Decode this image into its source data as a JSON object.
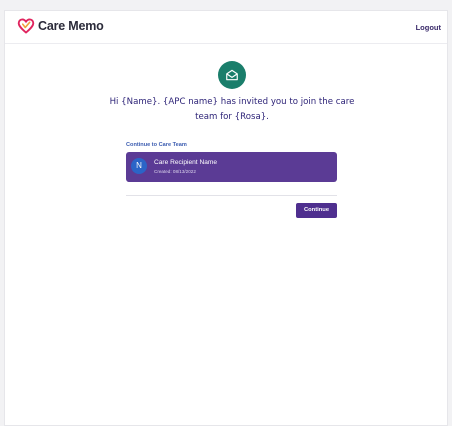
{
  "header": {
    "logo_text": "Care Memo",
    "logout_label": "Logout"
  },
  "invite": {
    "icon": "envelope-open-icon",
    "headline": "Hi {Name}. {APC name} has invited you to join the care team for {Rosa}."
  },
  "care_team": {
    "section_label": "Continue to Care Team",
    "recipient": {
      "avatar_initial": "N",
      "name": "Care Recipient Name",
      "created": "Created: 08/13/2022"
    }
  },
  "actions": {
    "continue_label": "Continue"
  },
  "colors": {
    "brand_heart": "#e0245e",
    "icon_bg": "#1a7e6b",
    "headline": "#2e2478",
    "card_bg": "#5b3b95",
    "avatar_bg": "#2b64c7",
    "button_bg": "#4f2f8f"
  }
}
